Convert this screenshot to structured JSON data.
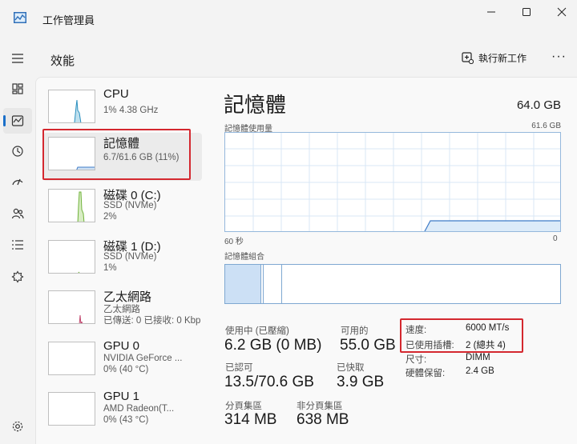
{
  "window": {
    "title": "工作管理員"
  },
  "header": {
    "title": "效能",
    "run_new_task": "執行新工作",
    "more": "···"
  },
  "colors": {
    "accent": "#1a6fc9",
    "memory": "#3e7bc7",
    "disk": "#6fb23a",
    "network": "#c1466e",
    "highlight": "#d4282f"
  },
  "rail": {
    "items": [
      "menu-icon",
      "processes-icon",
      "performance-icon",
      "history-icon",
      "startup-icon",
      "users-icon",
      "details-icon",
      "services-icon",
      "settings-icon"
    ],
    "active": "performance-icon"
  },
  "perf_list": [
    {
      "name": "CPU",
      "line1": "1% 4.38 GHz",
      "line2": ""
    },
    {
      "name": "記憶體",
      "line1": "6.7/61.6 GB (11%)",
      "line2": ""
    },
    {
      "name": "磁碟 0 (C:)",
      "line1": "SSD (NVMe)",
      "line2": "2%"
    },
    {
      "name": "磁碟 1 (D:)",
      "line1": "SSD (NVMe)",
      "line2": "1%"
    },
    {
      "name": "乙太網路",
      "line1": "乙太網路",
      "line2": "已傳送: 0 已接收: 0 Kbp"
    },
    {
      "name": "GPU 0",
      "line1": "NVIDIA GeForce ...",
      "line2": "0% (40 °C)"
    },
    {
      "name": "GPU 1",
      "line1": "AMD Radeon(T...",
      "line2": "0% (43 °C)"
    }
  ],
  "detail": {
    "title": "記憶體",
    "total": "64.0 GB",
    "usage_label": "記憶體使用量",
    "usage_max": "61.6 GB",
    "time_left": "60 秒",
    "time_right": "0",
    "composition_label": "記憶體組合",
    "in_use_label": "使用中 (已壓縮)",
    "in_use_value": "6.2 GB (0 MB)",
    "available_label": "可用的",
    "available_value": "55.0 GB",
    "committed_label": "已認可",
    "committed_value": "13.5/70.6 GB",
    "cached_label": "已快取",
    "cached_value": "3.9 GB",
    "paged_label": "分頁集區",
    "paged_value": "314 MB",
    "nonpaged_label": "非分頁集區",
    "nonpaged_value": "638 MB",
    "specs": [
      {
        "label": "速度:",
        "value": "6000 MT/s"
      },
      {
        "label": "已使用插槽:",
        "value": "2 (總共 4)"
      },
      {
        "label": "尺寸:",
        "value": "DIMM"
      },
      {
        "label": "硬體保留:",
        "value": "2.4 GB"
      }
    ]
  }
}
